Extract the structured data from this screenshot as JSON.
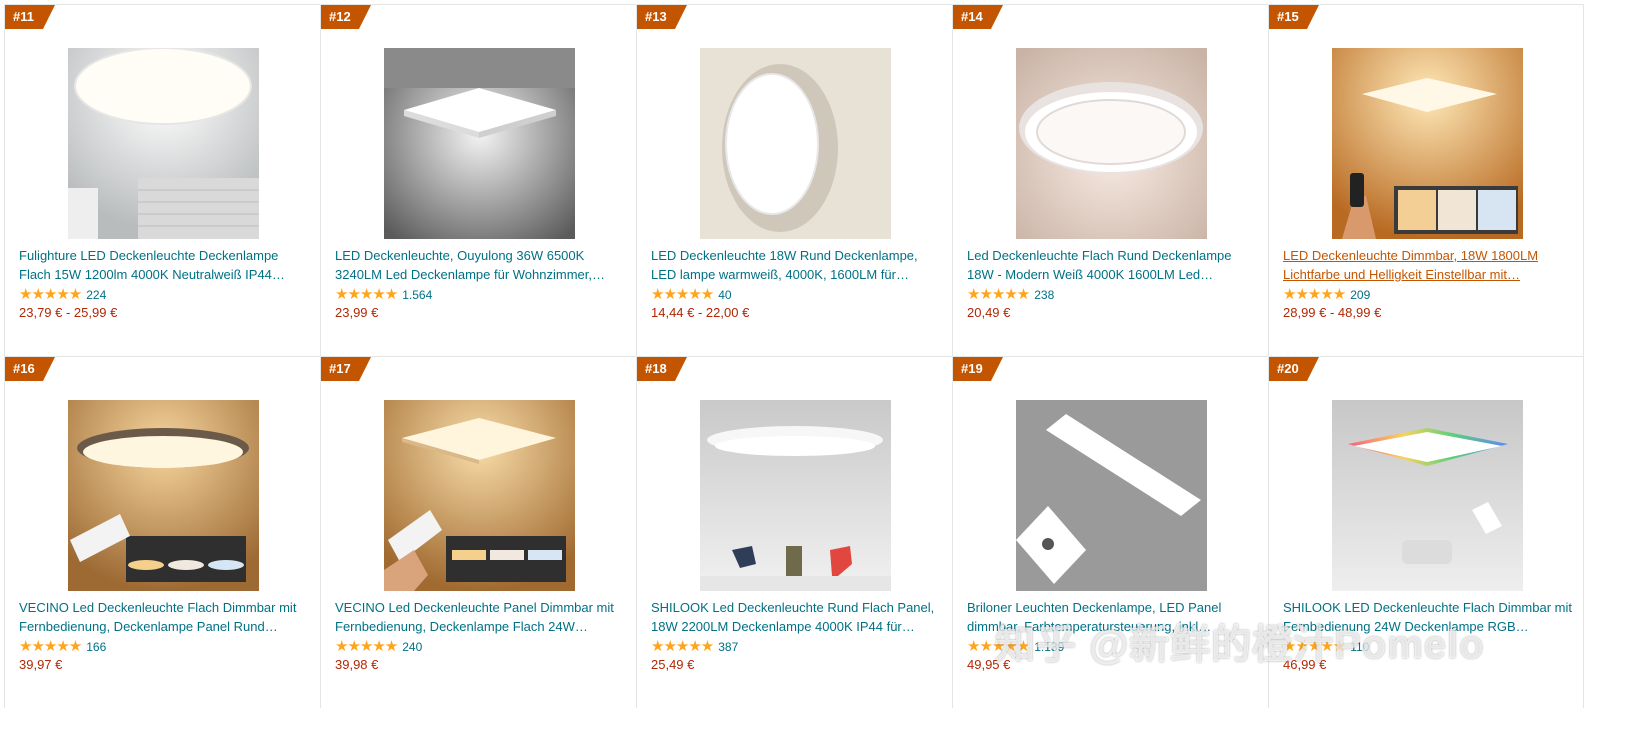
{
  "products": [
    {
      "rank": "#11",
      "title": "Fulighture LED Deckenleuchte Deckenlampe Flach 15W 1200lm 4000K Neutralweiß IP44…",
      "stars": "★★★★★",
      "reviews": "224",
      "price": "23,79 € - 25,99 €"
    },
    {
      "rank": "#12",
      "title": "LED Deckenleuchte, Ouyulong 36W 6500K 3240LM Led Deckenlampe für Wohnzimmer,…",
      "stars": "★★★★★",
      "reviews": "1.564",
      "price": "23,99 €"
    },
    {
      "rank": "#13",
      "title": "LED Deckenleuchte 18W Rund Deckenlampe, LED lampe warmweiß, 4000K, 1600LM für…",
      "stars": "★★★★★",
      "reviews": "40",
      "price": "14,44 € - 22,00 €"
    },
    {
      "rank": "#14",
      "title": "Led Deckenleuchte Flach Rund Deckenlampe 18W - Modern Weiß 4000K 1600LM Led…",
      "stars": "★★★★★",
      "reviews": "238",
      "price": "20,49 €"
    },
    {
      "rank": "#15",
      "title": "LED Deckenleuchte Dimmbar, 18W 1800LM Lichtfarbe und Helligkeit Einstellbar mit…",
      "stars": "★★★★★",
      "reviews": "209",
      "price": "28,99 € - 48,99 €"
    },
    {
      "rank": "#16",
      "title": "VECINO Led Deckenleuchte Flach Dimmbar mit Fernbedienung, Deckenlampe Panel Rund…",
      "stars": "★★★★★",
      "reviews": "166",
      "price": "39,97 €"
    },
    {
      "rank": "#17",
      "title": "VECINO Led Deckenleuchte Panel Dimmbar mit Fernbedienung, Deckenlampe Flach 24W…",
      "stars": "★★★★★",
      "reviews": "240",
      "price": "39,98 €"
    },
    {
      "rank": "#18",
      "title": "SHILOOK Led Deckenleuchte Rund Flach Panel, 18W 2200LM Deckenlampe 4000K IP44 für…",
      "stars": "★★★★★",
      "reviews": "387",
      "price": "25,49 €"
    },
    {
      "rank": "#19",
      "title": "Briloner Leuchten Deckenlampe, LED Panel dimmbar, Farbtemperatursteuerung, inkl…",
      "stars": "★★★★★",
      "reviews": "1.139",
      "price": "49,95 €"
    },
    {
      "rank": "#20",
      "title": "SHILOOK LED Deckenleuchte Flach Dimmbar mit Fernbedienung 24W Deckenlampe RGB…",
      "stars": "★★★★★",
      "reviews": "110",
      "price": "46,99 €"
    }
  ],
  "watermark": "知乎 @新鲜的橙汁Pomelo",
  "colors": {
    "rank_badge": "#c45500",
    "link": "#007185",
    "price": "#b12704",
    "star": "#ffa41c"
  }
}
